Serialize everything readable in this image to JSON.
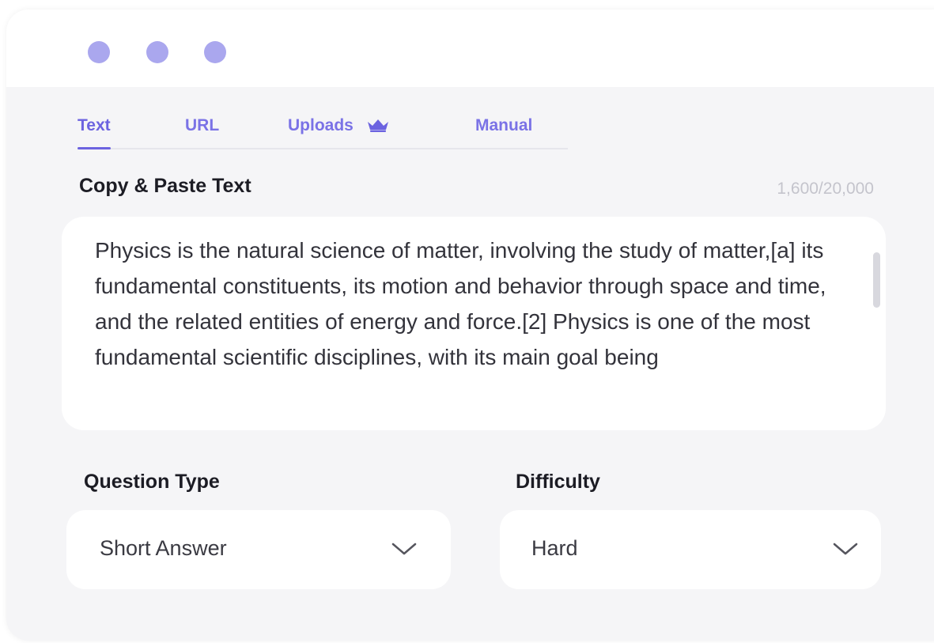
{
  "colors": {
    "accent": "#6c63e0",
    "dot": "#aaa7ee",
    "inactive_tab": "#7a72e6"
  },
  "tabs": [
    {
      "label": "Text",
      "active": true
    },
    {
      "label": "URL",
      "active": false
    },
    {
      "label": "Uploads",
      "active": false,
      "icon": "crown-icon"
    },
    {
      "label": "Manual",
      "active": false
    }
  ],
  "text_input": {
    "title": "Copy & Paste Text",
    "counter": "1,600/20,000",
    "content": "Physics is the natural science of matter, involving the study of matter,[a] its fundamental constituents, its motion and behavior through  space and time, and the related entities of energy and force.[2] Physics is one of the most fundamental scientific disciplines, with its main goal being"
  },
  "question_type": {
    "label": "Question Type",
    "value": "Short Answer",
    "icon": "chevron-down-icon"
  },
  "difficulty": {
    "label": "Difficulty",
    "value": "Hard",
    "icon": "chevron-down-icon"
  },
  "window_controls": [
    "dot-icon",
    "dot-icon",
    "dot-icon"
  ]
}
